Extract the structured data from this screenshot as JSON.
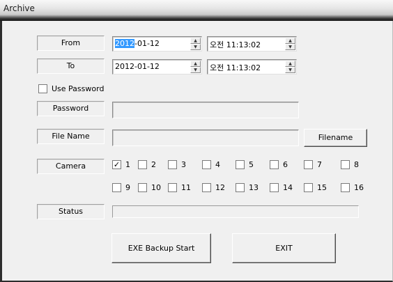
{
  "window": {
    "title": "Archive"
  },
  "from": {
    "label": "From",
    "date_highlight": "2012",
    "date_rest": "-01-12",
    "time": "오전 11:13:02"
  },
  "to": {
    "label": "To",
    "date": "2012-01-12",
    "time": "오전 11:13:02"
  },
  "use_password": {
    "label": "Use Password",
    "checked": false
  },
  "password": {
    "label": "Password",
    "value": ""
  },
  "file_name": {
    "label": "File Name",
    "value": "",
    "button_label": "Filename"
  },
  "camera": {
    "label": "Camera",
    "row1": [
      {
        "n": "1",
        "checked": true
      },
      {
        "n": "2"
      },
      {
        "n": "3"
      },
      {
        "n": "4"
      },
      {
        "n": "5"
      },
      {
        "n": "6"
      },
      {
        "n": "7"
      },
      {
        "n": "8"
      }
    ],
    "row2": [
      {
        "n": "9"
      },
      {
        "n": "10"
      },
      {
        "n": "11"
      },
      {
        "n": "12"
      },
      {
        "n": "13"
      },
      {
        "n": "14"
      },
      {
        "n": "15"
      },
      {
        "n": "16"
      }
    ]
  },
  "status": {
    "label": "Status",
    "progress": 0
  },
  "buttons": {
    "backup": "EXE Backup Start",
    "exit": "EXIT"
  }
}
